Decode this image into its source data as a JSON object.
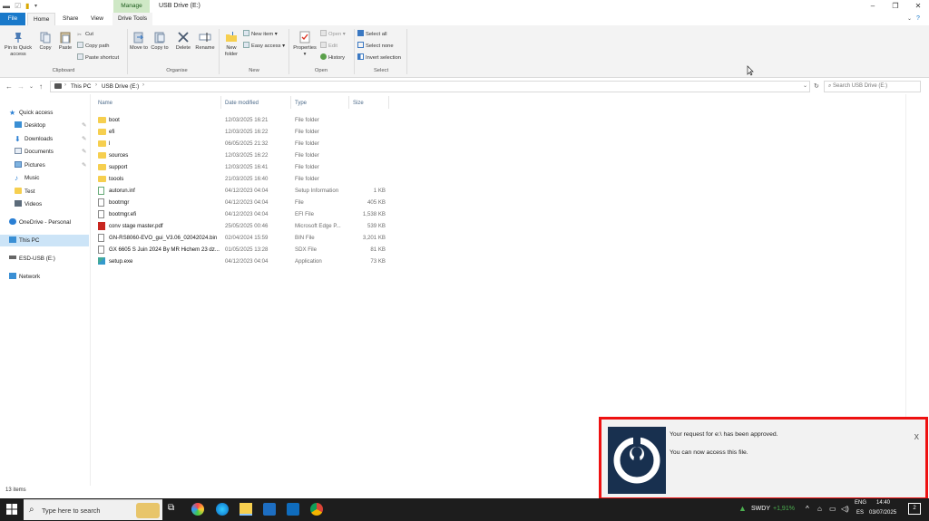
{
  "window": {
    "title": "USB Drive (E:)",
    "manage_tab": "Manage",
    "drive_tools_tab": "Drive Tools",
    "tabs": [
      "File",
      "Home",
      "Share",
      "View"
    ]
  },
  "ribbon": {
    "clipboard": {
      "group_label": "Clipboard",
      "pin": "Pin to Quick access",
      "copy": "Copy",
      "paste": "Paste",
      "cut": "Cut",
      "copy_path": "Copy path",
      "paste_shortcut": "Paste shortcut"
    },
    "organise": {
      "group_label": "Organise",
      "move_to": "Move to",
      "copy_to": "Copy to",
      "delete": "Delete",
      "rename": "Rename"
    },
    "new": {
      "group_label": "New",
      "new_folder": "New folder",
      "new_item": "New item",
      "easy_access": "Easy access"
    },
    "open": {
      "group_label": "Open",
      "properties": "Properties",
      "open": "Open",
      "edit": "Edit",
      "history": "History"
    },
    "select": {
      "group_label": "Select",
      "select_all": "Select all",
      "select_none": "Select none",
      "invert_selection": "Invert selection"
    }
  },
  "address": {
    "crumb1": "This PC",
    "crumb2": "USB Drive (E:)",
    "search_placeholder": "Search USB Drive (E:)"
  },
  "nav_pane": {
    "quick_access": "Quick access",
    "items": [
      "Desktop",
      "Downloads",
      "Documents",
      "Pictures",
      "Music",
      "Test",
      "Videos"
    ],
    "onedrive": "OneDrive - Personal",
    "this_pc": "This PC",
    "esd_usb": "ESD-USB (E:)",
    "network": "Network"
  },
  "columns": {
    "name": "Name",
    "date": "Date modified",
    "type": "Type",
    "size": "Size"
  },
  "files": [
    {
      "name": "boot",
      "date": "12/03/2025 16:21",
      "type": "File folder",
      "size": "",
      "icon": "folder"
    },
    {
      "name": "efi",
      "date": "12/03/2025 16:22",
      "type": "File folder",
      "size": "",
      "icon": "folder"
    },
    {
      "name": "l",
      "date": "06/05/2025 21:32",
      "type": "File folder",
      "size": "",
      "icon": "folder"
    },
    {
      "name": "sources",
      "date": "12/03/2025 16:22",
      "type": "File folder",
      "size": "",
      "icon": "folder"
    },
    {
      "name": "support",
      "date": "12/03/2025 16:41",
      "type": "File folder",
      "size": "",
      "icon": "folder"
    },
    {
      "name": "toools",
      "date": "21/03/2025 16:40",
      "type": "File folder",
      "size": "",
      "icon": "folder"
    },
    {
      "name": "autorun.inf",
      "date": "04/12/2023 04:04",
      "type": "Setup Information",
      "size": "1 KB",
      "icon": "inf"
    },
    {
      "name": "bootmgr",
      "date": "04/12/2023 04:04",
      "type": "File",
      "size": "405 KB",
      "icon": "file"
    },
    {
      "name": "bootmgr.efi",
      "date": "04/12/2023 04:04",
      "type": "EFI File",
      "size": "1,538 KB",
      "icon": "file"
    },
    {
      "name": "conv stage master.pdf",
      "date": "25/05/2025 00:46",
      "type": "Microsoft Edge P...",
      "size": "539 KB",
      "icon": "pdf"
    },
    {
      "name": "GN-RS8060-EVO_gui_V3.06_02042024.bin",
      "date": "02/04/2024 15:59",
      "type": "BIN File",
      "size": "3,201 KB",
      "icon": "file"
    },
    {
      "name": "GX 6605 S Juin 2024 By MR Hichem 23 dz...",
      "date": "01/05/2025 13:28",
      "type": "SDX File",
      "size": "81 KB",
      "icon": "file"
    },
    {
      "name": "setup.exe",
      "date": "04/12/2023 04:04",
      "type": "Application",
      "size": "73 KB",
      "icon": "exe"
    }
  ],
  "status": {
    "item_count": "13 items"
  },
  "notification": {
    "line1": "Your request for e:\\ has been approved.",
    "line2": "You can now access this file.",
    "close": "X"
  },
  "taskbar": {
    "search_placeholder": "Type here to search",
    "stock_name": "SWDY",
    "stock_change": "+1,91%",
    "lang1": "ENG",
    "lang2": "ES",
    "time": "14:40",
    "date": "03/07/2025",
    "notif_count": "2"
  }
}
